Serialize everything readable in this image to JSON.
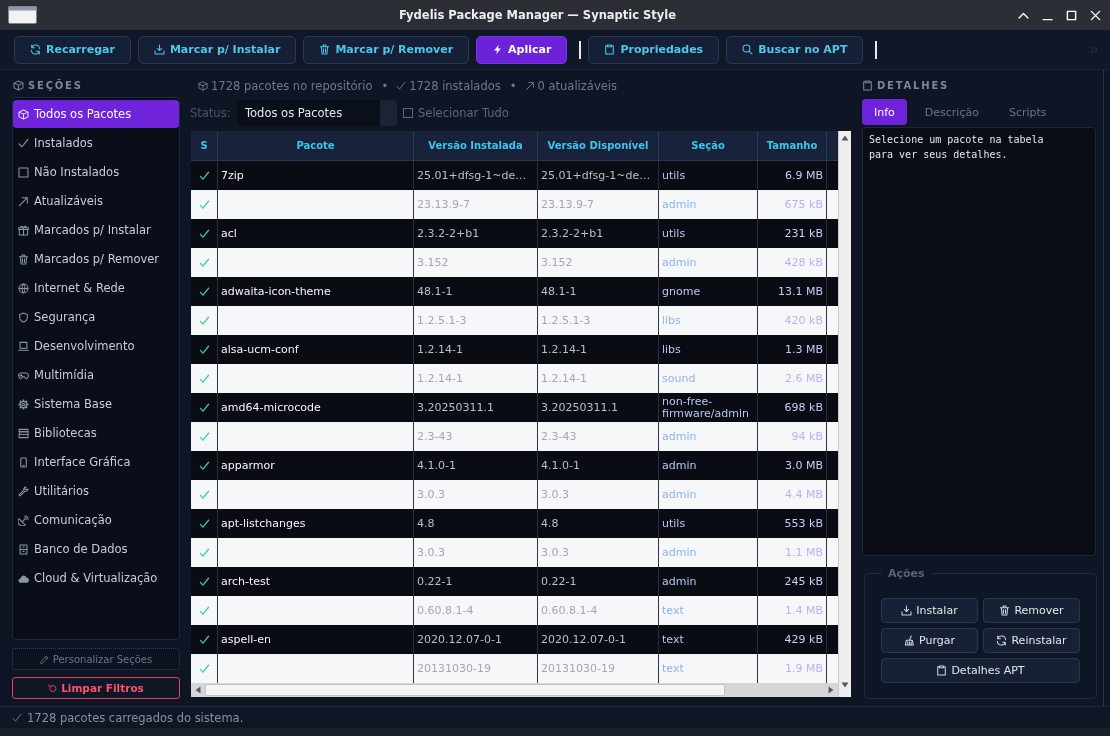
{
  "window": {
    "title": "Fydelis Package Manager — Synaptic Style"
  },
  "toolbar": {
    "items": [
      {
        "kind": "button",
        "label": "Recarregar"
      },
      {
        "kind": "button",
        "label": "Marcar p/ Instalar"
      },
      {
        "kind": "button",
        "label": "Marcar p/ Remover"
      },
      {
        "kind": "primary",
        "label": "Aplicar"
      },
      {
        "kind": "separator"
      },
      {
        "kind": "button",
        "label": "Propriedades"
      },
      {
        "kind": "button",
        "label": "Buscar no APT"
      },
      {
        "kind": "separator"
      }
    ]
  },
  "sidebar": {
    "title": "SEÇÕES",
    "items": [
      {
        "label": "Todos os Pacotes",
        "selected": true
      },
      {
        "label": "Instalados",
        "selected": false
      },
      {
        "label": "Não Instalados",
        "selected": false
      },
      {
        "label": "Atualizáveis",
        "selected": false
      },
      {
        "label": "Marcados p/ Instalar",
        "selected": false
      },
      {
        "label": "Marcados p/ Remover",
        "selected": false
      },
      {
        "label": "Internet & Rede",
        "selected": false
      },
      {
        "label": "Segurança",
        "selected": false
      },
      {
        "label": "Desenvolvimento",
        "selected": false
      },
      {
        "label": "Multimídia",
        "selected": false
      },
      {
        "label": "Sistema Base",
        "selected": false
      },
      {
        "label": "Bibliotecas",
        "selected": false
      },
      {
        "label": "Interface Gráfica",
        "selected": false
      },
      {
        "label": "Utilitários",
        "selected": false
      },
      {
        "label": "Comunicação",
        "selected": false
      },
      {
        "label": "Banco de Dados",
        "selected": false
      },
      {
        "label": "Cloud & Virtualização",
        "selected": false
      }
    ],
    "customize": "Personalizar Seções",
    "clear_filters": "Limpar Filtros"
  },
  "summary": [
    {
      "text": "1728 pacotes no repositório"
    },
    {
      "separator": "•",
      "text": "1728 instalados"
    },
    {
      "separator": "•",
      "text": "0 atualizáveis"
    }
  ],
  "filter": {
    "label": "Status:",
    "value": "Todos os Pacotes",
    "select_all": {
      "label": "Selecionar Tudo",
      "checked": false
    }
  },
  "table": {
    "columns": [
      "S",
      "Pacote",
      "Versão Instalada",
      "Versão Disponível",
      "Seção",
      "Tamanho"
    ],
    "rows": [
      {
        "package": "7zip",
        "installed_version": "25.01+dfsg-1~de…",
        "available_version": "25.01+dfsg-1~de…",
        "section": "utils",
        "size": "6.9 MB",
        "installed": true
      },
      {
        "installed_version": "23.13.9-7",
        "available_version": "23.13.9-7",
        "section": "admin",
        "size": "675 kB",
        "installed": true
      },
      {
        "package": "acl",
        "installed_version": "2.3.2-2+b1",
        "available_version": "2.3.2-2+b1",
        "section": "utils",
        "size": "231 kB",
        "installed": true
      },
      {
        "installed_version": "3.152",
        "available_version": "3.152",
        "section": "admin",
        "size": "428 kB",
        "installed": true
      },
      {
        "package": "adwaita-icon-theme",
        "installed_version": "48.1-1",
        "available_version": "48.1-1",
        "section": "gnome",
        "size": "13.1 MB",
        "installed": true
      },
      {
        "installed_version": "1.2.5.1-3",
        "available_version": "1.2.5.1-3",
        "section": "libs",
        "size": "420 kB",
        "installed": true
      },
      {
        "package": "alsa-ucm-conf",
        "installed_version": "1.2.14-1",
        "available_version": "1.2.14-1",
        "section": "libs",
        "size": "1.3 MB",
        "installed": true
      },
      {
        "installed_version": "1.2.14-1",
        "available_version": "1.2.14-1",
        "section": "sound",
        "size": "2.6 MB",
        "installed": true
      },
      {
        "package": "amd64-microcode",
        "installed_version": "3.20250311.1",
        "available_version": "3.20250311.1",
        "section": "non-free-firmware/admin",
        "size": "698 kB",
        "installed": true
      },
      {
        "installed_version": "2.3-43",
        "available_version": "2.3-43",
        "section": "admin",
        "size": "94 kB",
        "installed": true
      },
      {
        "package": "apparmor",
        "installed_version": "4.1.0-1",
        "available_version": "4.1.0-1",
        "section": "admin",
        "size": "3.0 MB",
        "installed": true
      },
      {
        "installed_version": "3.0.3",
        "available_version": "3.0.3",
        "section": "admin",
        "size": "4.4 MB",
        "installed": true
      },
      {
        "package": "apt-listchanges",
        "installed_version": "4.8",
        "available_version": "4.8",
        "section": "utils",
        "size": "553 kB",
        "installed": true
      },
      {
        "installed_version": "3.0.3",
        "available_version": "3.0.3",
        "section": "admin",
        "size": "1.1 MB",
        "installed": true
      },
      {
        "package": "arch-test",
        "installed_version": "0.22-1",
        "available_version": "0.22-1",
        "section": "admin",
        "size": "245 kB",
        "installed": true
      },
      {
        "installed_version": "0.60.8.1-4",
        "available_version": "0.60.8.1-4",
        "section": "text",
        "size": "1.4 MB",
        "installed": true
      },
      {
        "package": "aspell-en",
        "installed_version": "2020.12.07-0-1",
        "available_version": "2020.12.07-0-1",
        "section": "text",
        "size": "429 kB",
        "installed": true
      },
      {
        "installed_version": "20131030-19",
        "available_version": "20131030-19",
        "section": "text",
        "size": "1.9 MB",
        "installed": true
      }
    ]
  },
  "details": {
    "title": "DETALHES",
    "tabs": [
      {
        "label": "Info",
        "selected": true
      },
      {
        "label": "Descrição",
        "selected": false
      },
      {
        "label": "Scripts",
        "selected": false
      }
    ],
    "text": "Selecione um pacote na tabela\npara ver seus detalhes.",
    "actions_title": "Ações",
    "actions": [
      "Instalar",
      "Remover",
      "Purgar",
      "Reinstalar",
      "Detalhes APT"
    ]
  },
  "status_bar": {
    "text": "1728 pacotes carregados do sistema."
  }
}
